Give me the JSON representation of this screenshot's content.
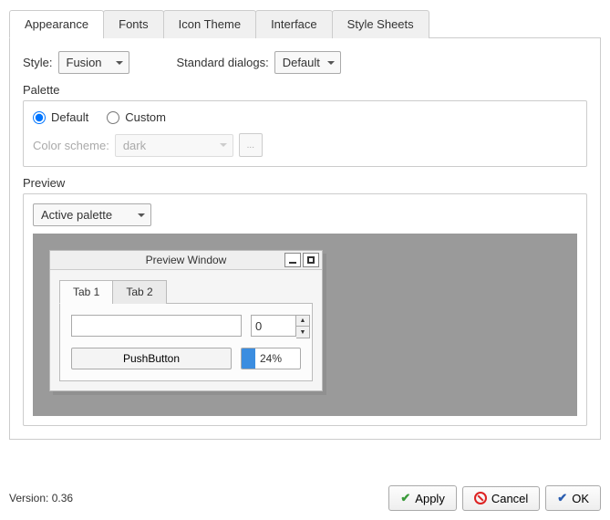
{
  "tabs": [
    "Appearance",
    "Fonts",
    "Icon Theme",
    "Interface",
    "Style Sheets"
  ],
  "style_label": "Style:",
  "style_value": "Fusion",
  "std_dialogs_label": "Standard dialogs:",
  "std_dialogs_value": "Default",
  "palette_label": "Palette",
  "palette_default": "Default",
  "palette_custom": "Custom",
  "color_scheme_label": "Color scheme:",
  "color_scheme_value": "dark",
  "color_scheme_btn": "...",
  "preview_label": "Preview",
  "active_palette": "Active palette",
  "window_title": "Preview Window",
  "inner_tabs": [
    "Tab 1",
    "Tab 2"
  ],
  "text_value": "",
  "spin_value": "0",
  "push_label": "PushButton",
  "progress_pct": "24%",
  "version": "Version: 0.36",
  "apply": "Apply",
  "cancel": "Cancel",
  "ok": "OK"
}
